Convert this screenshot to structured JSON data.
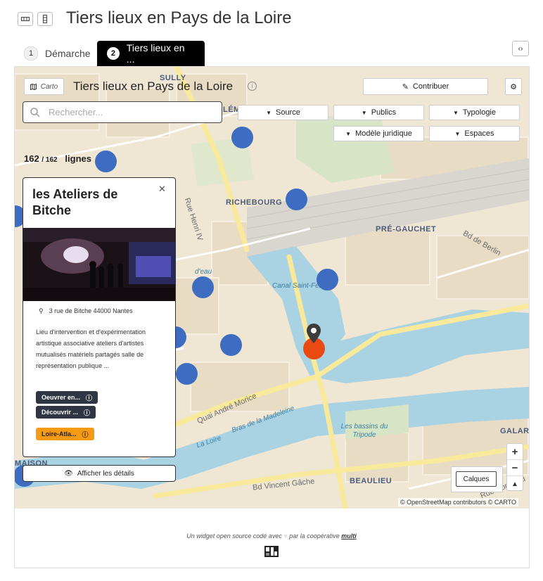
{
  "header": {
    "title": "Tiers lieux en Pays de la Loire",
    "btn_a_icon": "horizontal-layout-icon",
    "btn_b_icon": "vertical-layout-icon"
  },
  "tabs": [
    {
      "num": "1",
      "label": "Démarche"
    },
    {
      "num": "2",
      "label": "Tiers lieux en ..."
    }
  ],
  "map_header": {
    "carto_label": "Carto",
    "title": "Tiers lieux en Pays de la Loire",
    "contribute_label": "Contribuer",
    "settings_icon": "gear-icon"
  },
  "search": {
    "placeholder": "Rechercher..."
  },
  "filters": [
    "Source",
    "Publics",
    "Typologie",
    "Modèle juridique",
    "Espaces"
  ],
  "counter": {
    "shown": "162",
    "total": "162",
    "unit": "lignes"
  },
  "map_labels": {
    "districts": [
      "SULLY",
      "RICHEBOURG",
      "PRÉ-GAUCHET",
      "BEAULIEU",
      "GALAR",
      "LÉM",
      "MAISON"
    ],
    "streets": [
      "Rue Henri IV",
      "Bd de Berlin",
      "Quai André Morice",
      "Bd Vincent Gâche",
      "Rue Rondeau"
    ],
    "water": [
      "Canal Saint-Félix",
      "Bras de la Madeleine",
      "La Loire",
      "Les bassins du Tripode",
      "d'eau"
    ]
  },
  "card": {
    "title": "les Ateliers de Bitche",
    "address": "3 rue de Bitche 44000 Nantes",
    "description": "Lieu d'intervention et d'expérimentation artistique associative ateliers d'artistes mutualisés matériels partagés salle de représentation publique ...",
    "chips": [
      "Oeuvrer en...",
      "Découvrir ...",
      "Loire-Atla..."
    ],
    "details_label": "Afficher les détails"
  },
  "map_controls": {
    "zoom_in": "+",
    "zoom_out": "−",
    "reset": "▲",
    "layers_label": "Calques",
    "attribution": "© OpenStreetMap contributors © CARTO"
  },
  "footer": {
    "text_before": "Un widget open source codé avec",
    "text_after": "par la coopérative",
    "link": "multi"
  },
  "colors": {
    "marker": "#3d6cc0",
    "selected_marker": "#ea4a12",
    "active_tab": "#000000",
    "chip_dark": "#2f3542",
    "chip_orange": "#f49a14"
  }
}
